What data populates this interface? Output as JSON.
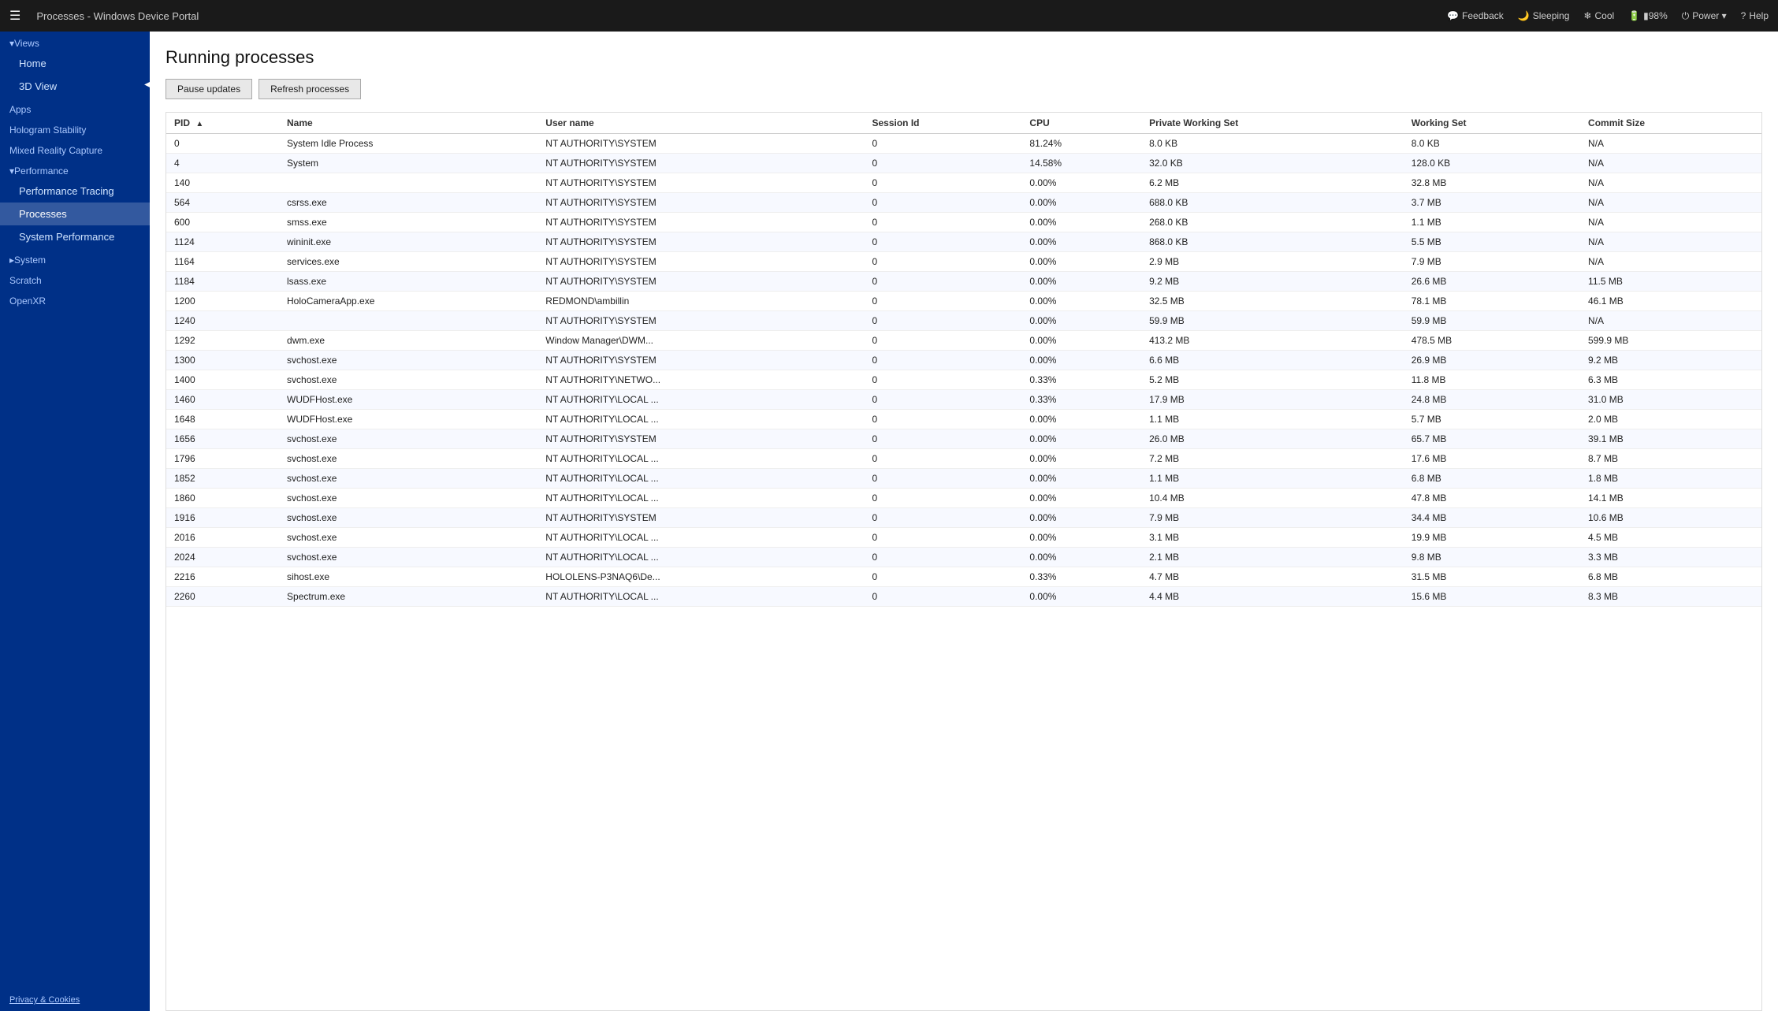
{
  "header": {
    "title": "Processes - Windows Device Portal",
    "hamburger": "☰",
    "actions": [
      {
        "id": "feedback",
        "icon": "💬",
        "label": "Feedback"
      },
      {
        "id": "sleeping",
        "icon": "🌙",
        "label": "Sleeping"
      },
      {
        "id": "cool",
        "icon": "❄",
        "label": "Cool"
      },
      {
        "id": "battery",
        "icon": "🔋",
        "label": "▮98%"
      },
      {
        "id": "power",
        "icon": "⏻",
        "label": "Power ▾"
      },
      {
        "id": "help",
        "icon": "?",
        "label": "Help"
      }
    ]
  },
  "sidebar": {
    "collapse_icon": "◀",
    "sections": [
      {
        "id": "views",
        "label": "▾Views",
        "items": [
          {
            "id": "home",
            "label": "Home",
            "active": false
          },
          {
            "id": "3dview",
            "label": "3D View",
            "active": false
          }
        ]
      },
      {
        "id": "apps-section",
        "label": "Apps",
        "items": []
      },
      {
        "id": "hologram",
        "label": "Hologram Stability",
        "items": []
      },
      {
        "id": "mixed-reality",
        "label": "Mixed Reality Capture",
        "items": []
      },
      {
        "id": "performance",
        "label": "▾Performance",
        "items": [
          {
            "id": "perf-tracing",
            "label": "Performance Tracing",
            "active": false
          },
          {
            "id": "processes",
            "label": "Processes",
            "active": true
          },
          {
            "id": "system-perf",
            "label": "System Performance",
            "active": false
          }
        ]
      },
      {
        "id": "system",
        "label": "▸System",
        "items": []
      },
      {
        "id": "scratch",
        "label": "Scratch",
        "items": []
      },
      {
        "id": "openxr",
        "label": "OpenXR",
        "items": []
      }
    ],
    "footer": "Privacy & Cookies"
  },
  "main": {
    "title": "Running processes",
    "buttons": [
      {
        "id": "pause-updates",
        "label": "Pause updates"
      },
      {
        "id": "refresh-processes",
        "label": "Refresh processes"
      }
    ],
    "table": {
      "columns": [
        {
          "id": "pid",
          "label": "PID",
          "sort": true,
          "sort_asc": true
        },
        {
          "id": "name",
          "label": "Name"
        },
        {
          "id": "username",
          "label": "User name"
        },
        {
          "id": "session",
          "label": "Session Id"
        },
        {
          "id": "cpu",
          "label": "CPU"
        },
        {
          "id": "private_ws",
          "label": "Private Working Set"
        },
        {
          "id": "working_set",
          "label": "Working Set"
        },
        {
          "id": "commit_size",
          "label": "Commit Size"
        }
      ],
      "rows": [
        {
          "pid": "0",
          "name": "System Idle Process",
          "username": "NT AUTHORITY\\SYSTEM",
          "session": "0",
          "cpu": "81.24%",
          "private_ws": "8.0 KB",
          "working_set": "8.0 KB",
          "commit_size": "N/A"
        },
        {
          "pid": "4",
          "name": "System",
          "username": "NT AUTHORITY\\SYSTEM",
          "session": "0",
          "cpu": "14.58%",
          "private_ws": "32.0 KB",
          "working_set": "128.0 KB",
          "commit_size": "N/A"
        },
        {
          "pid": "140",
          "name": "",
          "username": "NT AUTHORITY\\SYSTEM",
          "session": "0",
          "cpu": "0.00%",
          "private_ws": "6.2 MB",
          "working_set": "32.8 MB",
          "commit_size": "N/A"
        },
        {
          "pid": "564",
          "name": "csrss.exe",
          "username": "NT AUTHORITY\\SYSTEM",
          "session": "0",
          "cpu": "0.00%",
          "private_ws": "688.0 KB",
          "working_set": "3.7 MB",
          "commit_size": "N/A"
        },
        {
          "pid": "600",
          "name": "smss.exe",
          "username": "NT AUTHORITY\\SYSTEM",
          "session": "0",
          "cpu": "0.00%",
          "private_ws": "268.0 KB",
          "working_set": "1.1 MB",
          "commit_size": "N/A"
        },
        {
          "pid": "1124",
          "name": "wininit.exe",
          "username": "NT AUTHORITY\\SYSTEM",
          "session": "0",
          "cpu": "0.00%",
          "private_ws": "868.0 KB",
          "working_set": "5.5 MB",
          "commit_size": "N/A"
        },
        {
          "pid": "1164",
          "name": "services.exe",
          "username": "NT AUTHORITY\\SYSTEM",
          "session": "0",
          "cpu": "0.00%",
          "private_ws": "2.9 MB",
          "working_set": "7.9 MB",
          "commit_size": "N/A"
        },
        {
          "pid": "1184",
          "name": "lsass.exe",
          "username": "NT AUTHORITY\\SYSTEM",
          "session": "0",
          "cpu": "0.00%",
          "private_ws": "9.2 MB",
          "working_set": "26.6 MB",
          "commit_size": "11.5 MB"
        },
        {
          "pid": "1200",
          "name": "HoloCameraApp.exe",
          "username": "REDMOND\\ambillin",
          "session": "0",
          "cpu": "0.00%",
          "private_ws": "32.5 MB",
          "working_set": "78.1 MB",
          "commit_size": "46.1 MB"
        },
        {
          "pid": "1240",
          "name": "",
          "username": "NT AUTHORITY\\SYSTEM",
          "session": "0",
          "cpu": "0.00%",
          "private_ws": "59.9 MB",
          "working_set": "59.9 MB",
          "commit_size": "N/A"
        },
        {
          "pid": "1292",
          "name": "dwm.exe",
          "username": "Window Manager\\DWM...",
          "session": "0",
          "cpu": "0.00%",
          "private_ws": "413.2 MB",
          "working_set": "478.5 MB",
          "commit_size": "599.9 MB"
        },
        {
          "pid": "1300",
          "name": "svchost.exe",
          "username": "NT AUTHORITY\\SYSTEM",
          "session": "0",
          "cpu": "0.00%",
          "private_ws": "6.6 MB",
          "working_set": "26.9 MB",
          "commit_size": "9.2 MB"
        },
        {
          "pid": "1400",
          "name": "svchost.exe",
          "username": "NT AUTHORITY\\NETWO...",
          "session": "0",
          "cpu": "0.33%",
          "private_ws": "5.2 MB",
          "working_set": "11.8 MB",
          "commit_size": "6.3 MB"
        },
        {
          "pid": "1460",
          "name": "WUDFHost.exe",
          "username": "NT AUTHORITY\\LOCAL ...",
          "session": "0",
          "cpu": "0.33%",
          "private_ws": "17.9 MB",
          "working_set": "24.8 MB",
          "commit_size": "31.0 MB"
        },
        {
          "pid": "1648",
          "name": "WUDFHost.exe",
          "username": "NT AUTHORITY\\LOCAL ...",
          "session": "0",
          "cpu": "0.00%",
          "private_ws": "1.1 MB",
          "working_set": "5.7 MB",
          "commit_size": "2.0 MB"
        },
        {
          "pid": "1656",
          "name": "svchost.exe",
          "username": "NT AUTHORITY\\SYSTEM",
          "session": "0",
          "cpu": "0.00%",
          "private_ws": "26.0 MB",
          "working_set": "65.7 MB",
          "commit_size": "39.1 MB"
        },
        {
          "pid": "1796",
          "name": "svchost.exe",
          "username": "NT AUTHORITY\\LOCAL ...",
          "session": "0",
          "cpu": "0.00%",
          "private_ws": "7.2 MB",
          "working_set": "17.6 MB",
          "commit_size": "8.7 MB"
        },
        {
          "pid": "1852",
          "name": "svchost.exe",
          "username": "NT AUTHORITY\\LOCAL ...",
          "session": "0",
          "cpu": "0.00%",
          "private_ws": "1.1 MB",
          "working_set": "6.8 MB",
          "commit_size": "1.8 MB"
        },
        {
          "pid": "1860",
          "name": "svchost.exe",
          "username": "NT AUTHORITY\\LOCAL ...",
          "session": "0",
          "cpu": "0.00%",
          "private_ws": "10.4 MB",
          "working_set": "47.8 MB",
          "commit_size": "14.1 MB"
        },
        {
          "pid": "1916",
          "name": "svchost.exe",
          "username": "NT AUTHORITY\\SYSTEM",
          "session": "0",
          "cpu": "0.00%",
          "private_ws": "7.9 MB",
          "working_set": "34.4 MB",
          "commit_size": "10.6 MB"
        },
        {
          "pid": "2016",
          "name": "svchost.exe",
          "username": "NT AUTHORITY\\LOCAL ...",
          "session": "0",
          "cpu": "0.00%",
          "private_ws": "3.1 MB",
          "working_set": "19.9 MB",
          "commit_size": "4.5 MB"
        },
        {
          "pid": "2024",
          "name": "svchost.exe",
          "username": "NT AUTHORITY\\LOCAL ...",
          "session": "0",
          "cpu": "0.00%",
          "private_ws": "2.1 MB",
          "working_set": "9.8 MB",
          "commit_size": "3.3 MB"
        },
        {
          "pid": "2216",
          "name": "sihost.exe",
          "username": "HOLOLENS-P3NAQ6\\De...",
          "session": "0",
          "cpu": "0.33%",
          "private_ws": "4.7 MB",
          "working_set": "31.5 MB",
          "commit_size": "6.8 MB"
        },
        {
          "pid": "2260",
          "name": "Spectrum.exe",
          "username": "NT AUTHORITY\\LOCAL ...",
          "session": "0",
          "cpu": "0.00%",
          "private_ws": "4.4 MB",
          "working_set": "15.6 MB",
          "commit_size": "8.3 MB"
        }
      ]
    }
  }
}
